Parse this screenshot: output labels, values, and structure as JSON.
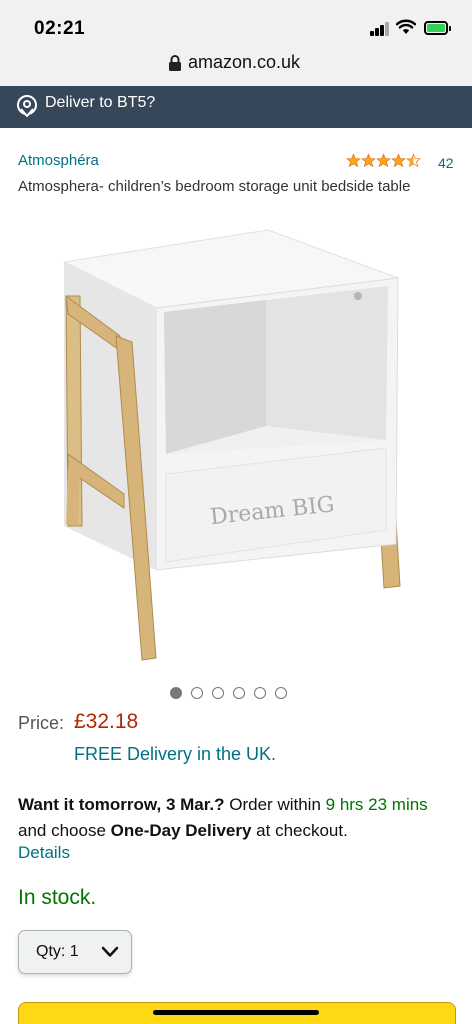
{
  "status_bar": {
    "time": "02:21",
    "icons": [
      "signal-icon",
      "wifi-icon",
      "battery-charging-icon"
    ]
  },
  "browser": {
    "url": "amazon.co.uk",
    "icon": "lock-icon"
  },
  "delivery_bar": {
    "text": "Deliver to BT5?",
    "icon": "location-pin-icon",
    "background": "#37475a"
  },
  "product": {
    "brand": "Atmosphéra",
    "rating_count": "42",
    "rating_stars": 4.5,
    "title": "Atmosphera- children’s bedroom storage unit bedside table",
    "image_text": "Dream BIG",
    "image_count": 6,
    "active_image": 1,
    "price_label": "Price:",
    "price": "£32.18",
    "free_delivery": "FREE Delivery in the UK.",
    "delivery": {
      "headline": "Want it tomorrow, 3 Mar.?",
      "order_within_prefix": "Order within",
      "order_within_time": "9 hrs 23 mins",
      "choose_prefix": "and choose",
      "option": "One-Day Delivery",
      "suffix": "at checkout.",
      "details_link": "Details"
    },
    "stock_status": "In stock.",
    "quantity_label": "Qty: 1"
  },
  "colors": {
    "link": "#007185",
    "price": "#b12704",
    "stock": "#007600",
    "star": "#ffa41c",
    "button": "#ffd814"
  }
}
